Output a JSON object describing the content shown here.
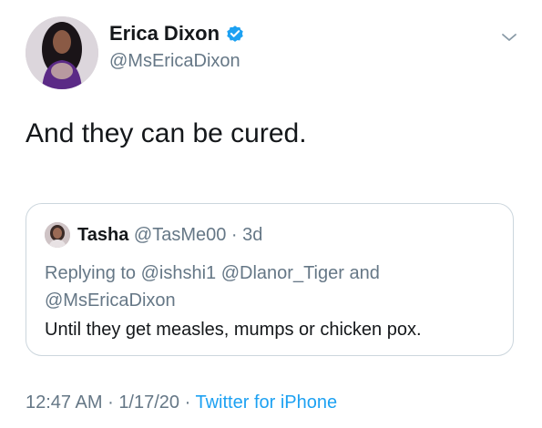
{
  "author": {
    "name": "Erica Dixon",
    "handle": "@MsEricaDixon",
    "verified": true,
    "verified_color": "#1da1f2"
  },
  "icons": {
    "more": "chevron-down-icon",
    "verified": "verified-badge-icon"
  },
  "tweet": {
    "text": "And they can be cured."
  },
  "quoted_tweet": {
    "name": "Tasha",
    "handle": "@TasMe00",
    "separator": "·",
    "time": "3d",
    "replying_label": "Replying to",
    "reply_mentions_line1": "@ishshi1 @Dlanor_Tiger and",
    "reply_mentions_line2": "@MsEricaDixon",
    "text": "Until they get measles, mumps or chicken pox."
  },
  "meta": {
    "time": "12:47 AM",
    "sep1": "·",
    "date": "1/17/20",
    "sep2": "·",
    "source": "Twitter for iPhone"
  },
  "colors": {
    "text": "#14171a",
    "secondary": "#657786",
    "link": "#1da1f2",
    "border": "#ccd6dd"
  }
}
